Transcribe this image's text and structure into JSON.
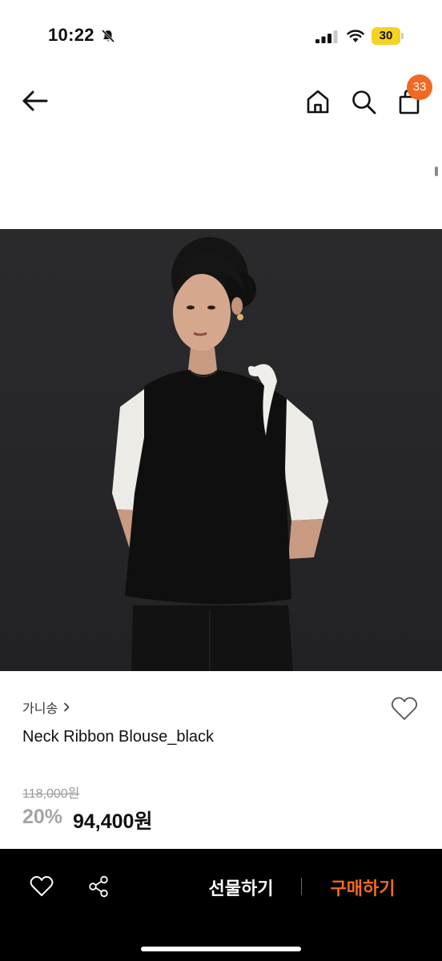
{
  "status_bar": {
    "time": "10:22",
    "battery": "30"
  },
  "nav": {
    "cart_count": "33"
  },
  "product": {
    "brand": "가니송",
    "name": "Neck Ribbon Blouse_black",
    "price_original": "118,000원",
    "discount_rate": "20%",
    "price_final": "94,400원"
  },
  "bottom_bar": {
    "gift_label": "선물하기",
    "buy_label": "구매하기"
  },
  "colors": {
    "accent": "#f26a21",
    "battery": "#f4d321",
    "bottom_bar_bg": "#000000",
    "image_bg": "#2a2a2d"
  },
  "icons": [
    "bell-slash-icon",
    "signal-icon",
    "wifi-icon",
    "back-arrow-icon",
    "home-icon",
    "search-icon",
    "shopping-bag-icon",
    "chevron-right-icon",
    "heart-icon",
    "share-icon"
  ]
}
